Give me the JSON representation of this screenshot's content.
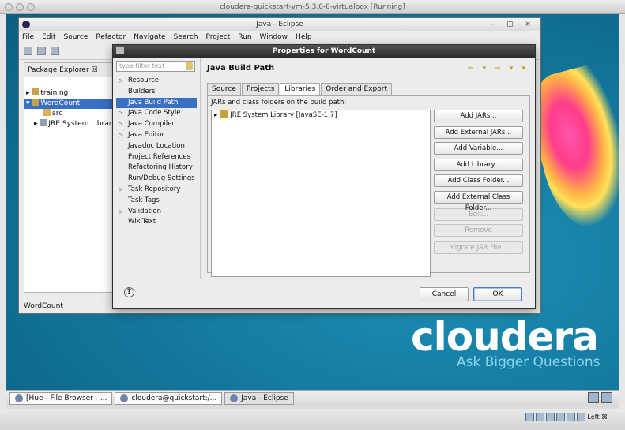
{
  "host": {
    "window_title": "cloudera-quickstart-vm-5.3.0-0-virtualbox [Running]",
    "status_right": "Left ⌘"
  },
  "desktop": {
    "brand": "cloudera",
    "tagline": "Ask Bigger Questions"
  },
  "taskbar": {
    "items": [
      {
        "label": "[Hue - File Browser - ..."
      },
      {
        "label": "cloudera@quickstart:/..."
      },
      {
        "label": "Java - Eclipse"
      }
    ]
  },
  "eclipse": {
    "title": "Java - Eclipse",
    "menu": [
      "File",
      "Edit",
      "Source",
      "Refactor",
      "Navigate",
      "Search",
      "Project",
      "Run",
      "Window",
      "Help"
    ],
    "package_explorer": {
      "tab": "Package Explorer ☒",
      "tree": [
        {
          "label": "training"
        },
        {
          "label": "WordCount"
        },
        {
          "label": "src"
        },
        {
          "label": "JRE System Library"
        }
      ]
    },
    "status": "WordCount"
  },
  "dialog": {
    "title": "Properties for WordCount",
    "filter_placeholder": "type filter text",
    "categories": [
      {
        "label": "Resource",
        "expandable": true
      },
      {
        "label": "Builders",
        "expandable": false
      },
      {
        "label": "Java Build Path",
        "expandable": false
      },
      {
        "label": "Java Code Style",
        "expandable": true
      },
      {
        "label": "Java Compiler",
        "expandable": true
      },
      {
        "label": "Java Editor",
        "expandable": true
      },
      {
        "label": "Javadoc Location",
        "expandable": false
      },
      {
        "label": "Project References",
        "expandable": false
      },
      {
        "label": "Refactoring History",
        "expandable": false
      },
      {
        "label": "Run/Debug Settings",
        "expandable": false
      },
      {
        "label": "Task Repository",
        "expandable": true
      },
      {
        "label": "Task Tags",
        "expandable": false
      },
      {
        "label": "Validation",
        "expandable": true
      },
      {
        "label": "WikiText",
        "expandable": false
      }
    ],
    "selected_category": "Java Build Path",
    "page_title": "Java Build Path",
    "tabs": [
      "Source",
      "Projects",
      "Libraries",
      "Order and Export"
    ],
    "active_tab": "Libraries",
    "list_label": "JARs and class folders on the build path:",
    "entries": [
      "JRE System Library [JavaSE-1.7]"
    ],
    "buttons": [
      {
        "label": "Add JARs...",
        "enabled": true
      },
      {
        "label": "Add External JARs...",
        "enabled": true
      },
      {
        "label": "Add Variable...",
        "enabled": true
      },
      {
        "label": "Add Library...",
        "enabled": true
      },
      {
        "label": "Add Class Folder...",
        "enabled": true
      },
      {
        "label": "Add External Class Folder...",
        "enabled": true
      },
      {
        "label": "Edit...",
        "enabled": false
      },
      {
        "label": "Remove",
        "enabled": false
      },
      {
        "label": "Migrate JAR File...",
        "enabled": false
      }
    ],
    "footer": {
      "cancel": "Cancel",
      "ok": "OK"
    }
  }
}
